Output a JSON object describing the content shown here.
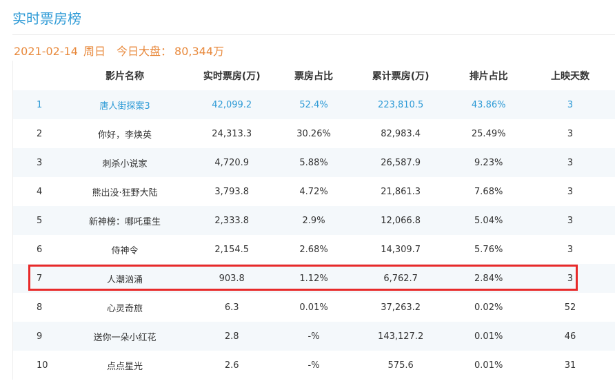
{
  "page": {
    "title": "实时票房榜"
  },
  "summary": {
    "date": "2021-02-14",
    "weekday": "周日",
    "label": "今日大盘：",
    "total": "80,344万"
  },
  "table": {
    "headers": [
      "",
      "影片名称",
      "实时票房(万)",
      "票房占比",
      "累计票房(万)",
      "排片占比",
      "上映天数"
    ],
    "rows": [
      [
        "1",
        "唐人街探案3",
        "42,099.2",
        "52.4%",
        "223,810.5",
        "43.86%",
        "3"
      ],
      [
        "2",
        "你好，李焕英",
        "24,313.3",
        "30.26%",
        "82,983.4",
        "25.49%",
        "3"
      ],
      [
        "3",
        "刺杀小说家",
        "4,720.9",
        "5.88%",
        "26,587.9",
        "9.23%",
        "3"
      ],
      [
        "4",
        "熊出没·狂野大陆",
        "3,793.8",
        "4.72%",
        "21,861.3",
        "7.68%",
        "3"
      ],
      [
        "5",
        "新神榜：哪吒重生",
        "2,333.8",
        "2.9%",
        "12,066.8",
        "5.04%",
        "3"
      ],
      [
        "6",
        "侍神令",
        "2,154.5",
        "2.68%",
        "14,309.7",
        "5.76%",
        "3"
      ],
      [
        "7",
        "人潮汹涌",
        "903.8",
        "1.12%",
        "6,762.7",
        "2.84%",
        "3"
      ],
      [
        "8",
        "心灵奇旅",
        "6.3",
        "0.01%",
        "37,263.2",
        "0.02%",
        "52"
      ],
      [
        "9",
        "送你一朵小红花",
        "2.8",
        "-%",
        "143,127.2",
        "0.01%",
        "46"
      ],
      [
        "10",
        "点点星光",
        "2.6",
        "-%",
        "575.6",
        "0.01%",
        "31"
      ]
    ]
  },
  "colors": {
    "title": "#2d9ad6",
    "summary": "#e8893c",
    "highlight_box": "#e82a2a",
    "alt_row": "#f4f8fb"
  }
}
